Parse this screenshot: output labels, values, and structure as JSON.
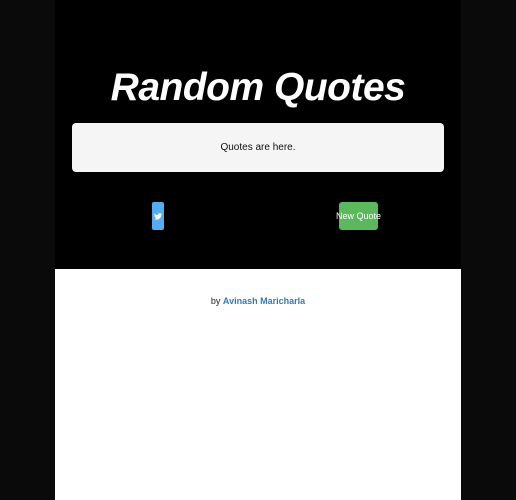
{
  "hero": {
    "title": "Random Quotes"
  },
  "quote": {
    "text": "Quotes are here."
  },
  "actions": {
    "tweet_icon": "twitter-icon",
    "new_quote_label": "New Quote"
  },
  "footer": {
    "by_prefix": "by",
    "author_name": "Avinash Maricharla"
  },
  "colors": {
    "hero_bg": "#000000",
    "outer_bg": "#0a0a0a",
    "tweet_button": "#55acee",
    "new_quote_button": "#5cb85c",
    "author_link": "#337ab7"
  }
}
